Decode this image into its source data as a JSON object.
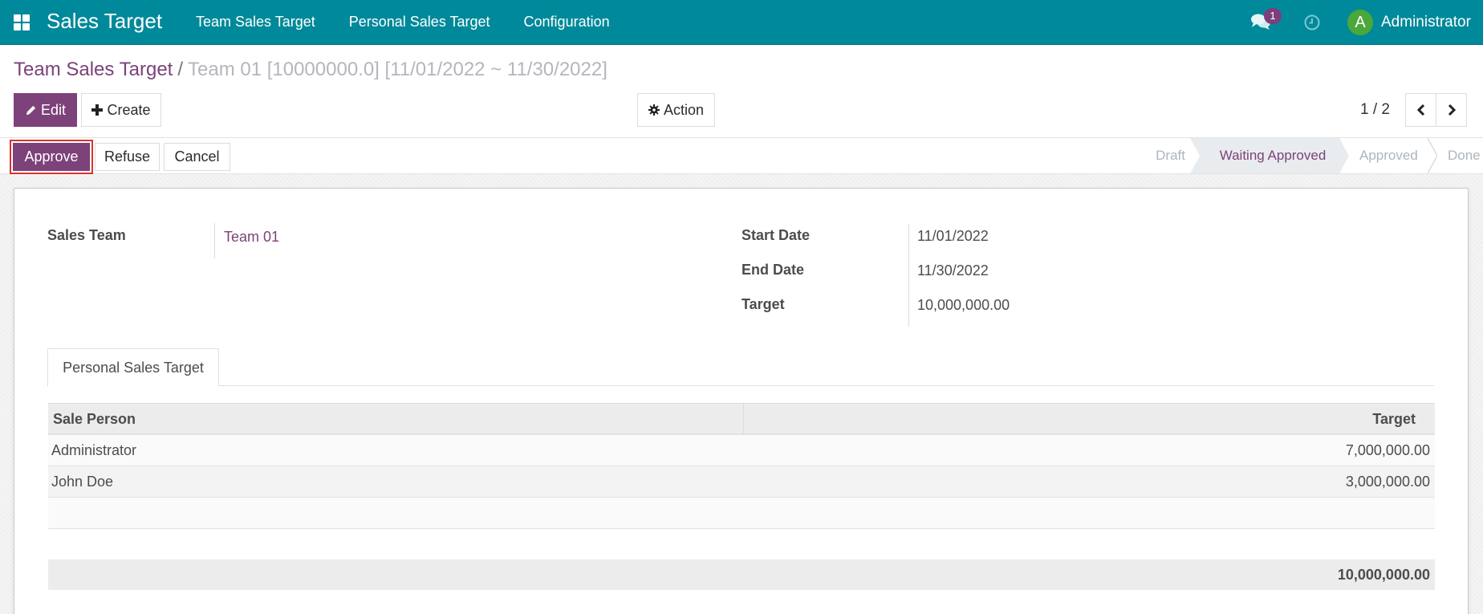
{
  "navbar": {
    "app_name": "Sales Target",
    "menu": [
      "Team Sales Target",
      "Personal Sales Target",
      "Configuration"
    ],
    "notifications_count": "1",
    "user_initial": "A",
    "user_name": "Administrator",
    "colors": {
      "bar": "#00899a",
      "badge": "#7c3f7b",
      "avatar": "#4ca73a"
    }
  },
  "breadcrumb": {
    "parent": "Team Sales Target",
    "separator": "/",
    "current": "Team 01 [10000000.0] [11/01/2022 ~ 11/30/2022]"
  },
  "toolbar": {
    "edit_label": "Edit",
    "create_label": "Create",
    "action_label": "Action",
    "pager": "1 / 2"
  },
  "statusbar": {
    "buttons": {
      "approve": "Approve",
      "refuse": "Refuse",
      "cancel": "Cancel"
    },
    "stages": [
      "Draft",
      "Waiting Approved",
      "Approved",
      "Done"
    ],
    "current_stage": "Waiting Approved"
  },
  "form": {
    "sales_team_label": "Sales Team",
    "sales_team_value": "Team 01",
    "start_date_label": "Start Date",
    "start_date_value": "11/01/2022",
    "end_date_label": "End Date",
    "end_date_value": "11/30/2022",
    "target_label": "Target",
    "target_value": "10,000,000.00"
  },
  "notebook": {
    "tab_label": "Personal Sales Target",
    "columns": [
      "Sale Person",
      "Target"
    ],
    "rows": [
      {
        "person": "Administrator",
        "target": "7,000,000.00"
      },
      {
        "person": "John Doe",
        "target": "3,000,000.00"
      }
    ],
    "total": "10,000,000.00"
  },
  "accent_color": "#7c4279",
  "highlight_color": "#d9342e"
}
